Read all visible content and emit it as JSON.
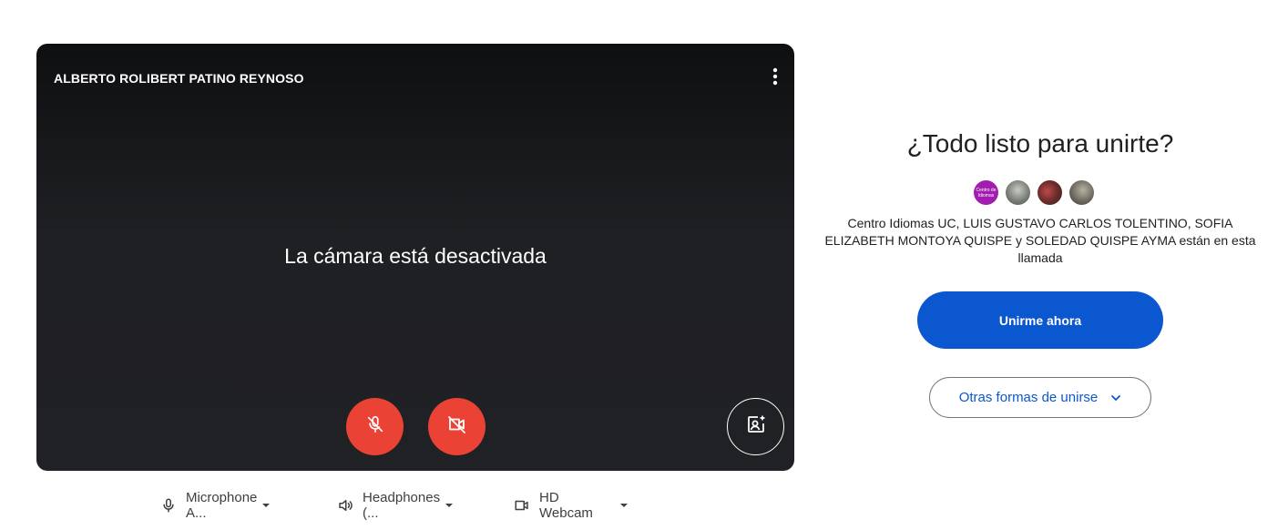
{
  "preview": {
    "participant_name": "ALBERTO ROLIBERT PATINO REYNOSO",
    "status_text": "La cámara está desactivada",
    "menu_icon": "more-vert-icon",
    "mic_icon": "mic-off-icon",
    "camera_icon": "videocam-off-icon",
    "effects_icon": "visual-effects-icon",
    "control_off_color": "#ea4335"
  },
  "devices": {
    "microphone_label": "Microphone A...",
    "speaker_label": "Headphones (...",
    "camera_label": "HD Webcam"
  },
  "join": {
    "title": "¿Todo listo para unirte?",
    "avatars": [
      {
        "name": "Centro Idiomas UC",
        "text": "Centro de Idiomas"
      },
      {
        "name": "LUIS GUSTAVO CARLOS TOLENTINO"
      },
      {
        "name": "SOFIA ELIZABETH MONTOYA QUISPE"
      },
      {
        "name": "SOLEDAD QUISPE AYMA"
      }
    ],
    "participants_text": "Centro Idiomas UC, LUIS GUSTAVO CARLOS TOLENTINO, SOFIA ELIZABETH MONTOYA QUISPE y SOLEDAD QUISPE AYMA están en esta llamada",
    "join_button_label": "Unirme ahora",
    "other_ways_label": "Otras formas de unirse",
    "accent_color": "#0b57d0"
  }
}
